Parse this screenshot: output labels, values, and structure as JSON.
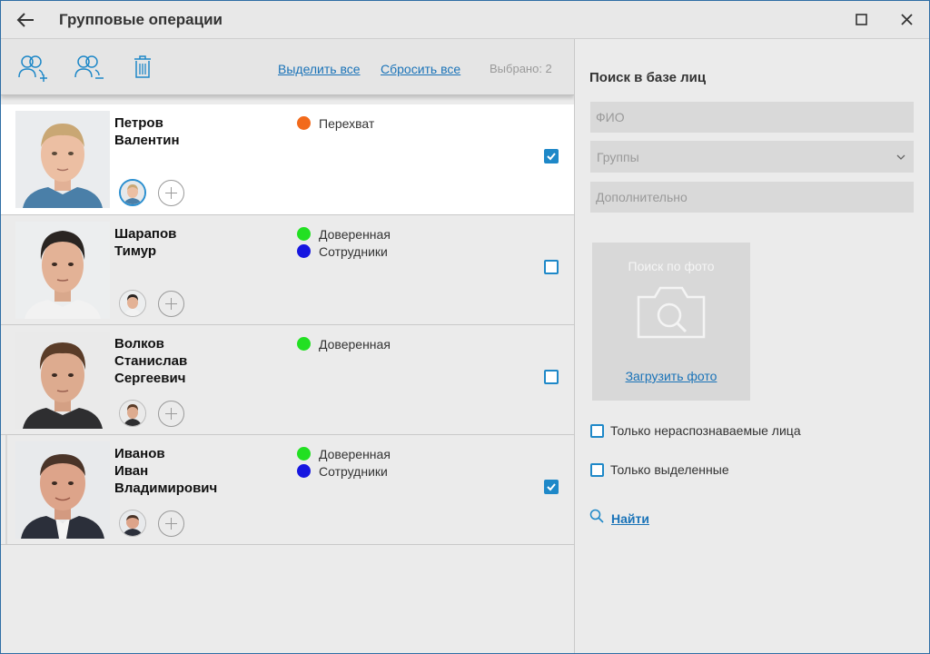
{
  "window": {
    "title": "Групповые операции"
  },
  "toolbar": {
    "select_all": "Выделить все",
    "reset_all": "Сбросить все",
    "selected_count": "Выбрано: 2"
  },
  "persons": [
    {
      "name_lines": [
        "Петров",
        "Валентин"
      ],
      "groups": [
        {
          "label": "Перехват",
          "color": "#f26a1b"
        }
      ],
      "checked": true
    },
    {
      "name_lines": [
        "Шарапов",
        "Тимур"
      ],
      "groups": [
        {
          "label": "Доверенная",
          "color": "#22e022"
        },
        {
          "label": "Сотрудники",
          "color": "#1616e0"
        }
      ],
      "checked": false
    },
    {
      "name_lines": [
        "Волков",
        "Станислав",
        "Сергеевич"
      ],
      "groups": [
        {
          "label": "Доверенная",
          "color": "#22e022"
        }
      ],
      "checked": false
    },
    {
      "name_lines": [
        "Иванов",
        "Иван",
        "Владимирович"
      ],
      "groups": [
        {
          "label": "Доверенная",
          "color": "#22e022"
        },
        {
          "label": "Сотрудники",
          "color": "#1616e0"
        }
      ],
      "checked": true
    }
  ],
  "search": {
    "title": "Поиск в базе лиц",
    "fio_placeholder": "ФИО",
    "groups_placeholder": "Группы",
    "extra_placeholder": "Дополнительно",
    "photo_search_label": "Поиск по фото",
    "upload_label": "Загрузить фото",
    "only_unrecognized": "Только нераспознаваемые лица",
    "only_selected": "Только выделенные",
    "find_label": "Найти"
  },
  "colors": {
    "accent": "#1e88c8",
    "link": "#1a73b8"
  }
}
